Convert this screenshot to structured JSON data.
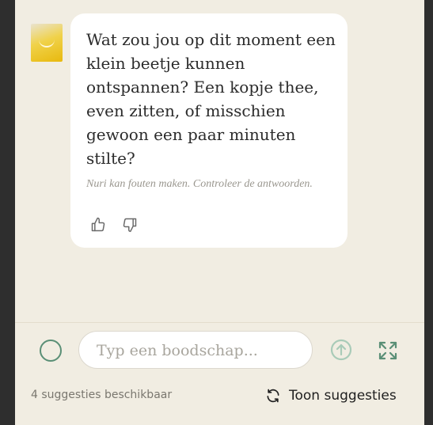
{
  "chat": {
    "message": "Wat zou jou op dit moment een klein beetje kunnen ontspannen? Een kopje thee, even zitten, of misschien gewoon een paar minuten stilte?",
    "disclaimer": "Nuri kan fouten maken. Controleer de antwoorden.",
    "feedback_icons": [
      "thumbs-up-icon",
      "thumbs-down-icon"
    ]
  },
  "composer": {
    "placeholder": "Typ een boodschap...",
    "value": "",
    "send_icon": "arrow-up-circle-icon",
    "expand_icon": "expand-icon"
  },
  "suggestions": {
    "count_text": "4 suggesties beschikbaar",
    "button_label": "Toon suggesties",
    "button_icon": "refresh-icon"
  },
  "colors": {
    "background": "#f1ede2",
    "bubble": "#ffffff",
    "accent_green": "#5a8f76",
    "send_disabled": "#a9cbb8"
  }
}
